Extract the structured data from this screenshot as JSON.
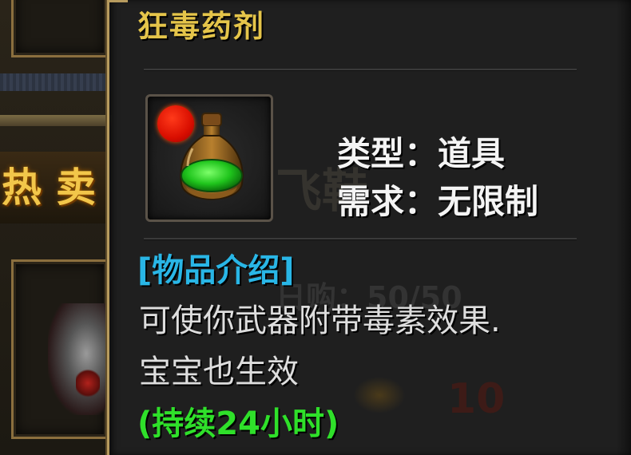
{
  "tooltip": {
    "item_name": "狂毒药剂",
    "item_icon": "green-potion-icon",
    "properties": {
      "type_label": "类型",
      "type_value": "道具",
      "requirement_label": "需求",
      "requirement_value": "无限制",
      "type_line": "类型：道具",
      "requirement_line": "需求：无限制"
    },
    "description_heading": "[物品介绍]",
    "description_lines": [
      "可使你武器附带毒素效果.",
      "宝宝也生效"
    ],
    "duration": "(持续24小时)"
  },
  "colors": {
    "title": "#e5c54a",
    "heading": "#29b6e6",
    "body_text": "#dedede",
    "duration": "#2fe02a",
    "border_gold": "#b79b5e"
  }
}
